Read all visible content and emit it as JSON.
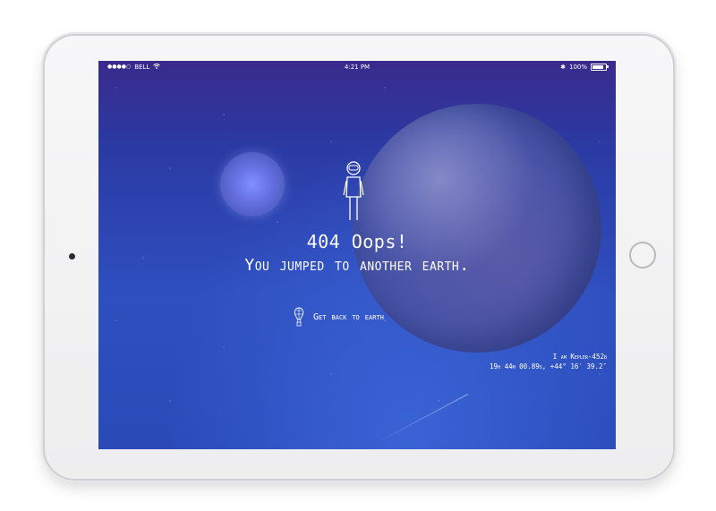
{
  "status_bar": {
    "carrier": "BELL",
    "time": "4:21 PM",
    "battery": "100%",
    "signal_dots": "●●●●○",
    "bluetooth_symbol": "✱"
  },
  "main": {
    "title": "404 Oops!",
    "subtitle": "You jumped to another earth.",
    "back_link": "Get back to earth",
    "planet_line1": "I am Kepler-452b",
    "planet_line2": "19h 44m 00.89s, +44° 16′ 39.2″"
  },
  "icons": {
    "astronaut": "astronaut-icon",
    "balloon": "hot-air-balloon-icon",
    "wifi": "wifi-icon",
    "battery": "battery-icon",
    "bluetooth": "bluetooth-icon",
    "signal": "signal-icon"
  },
  "colors": {
    "background_top": "#3a2a8c",
    "background_bottom": "#2f4fbf",
    "text": "#ffffff",
    "planet": "#4a55a8",
    "moon": "#6a74e6"
  }
}
